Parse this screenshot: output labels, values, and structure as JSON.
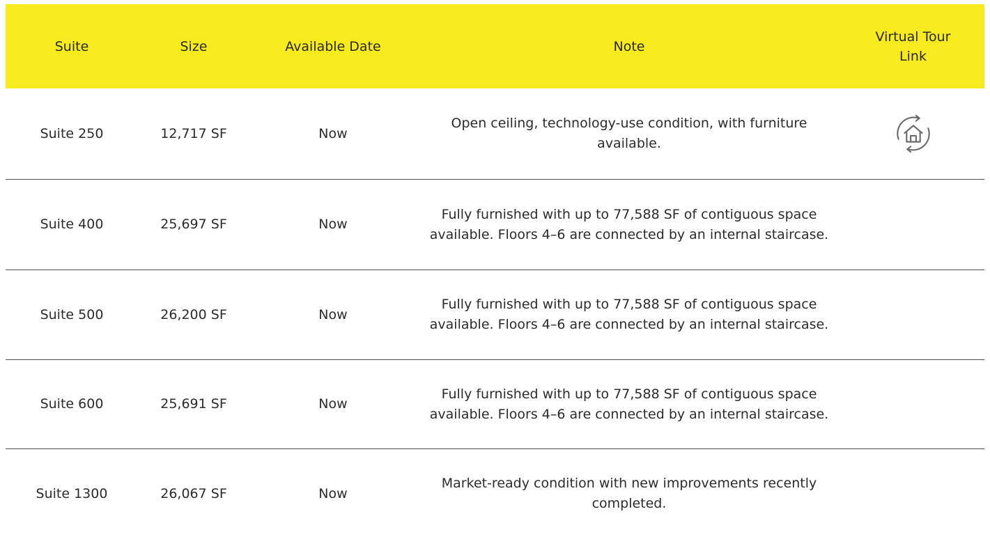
{
  "header": {
    "suite": "Suite",
    "size": "Size",
    "available_date": "Available Date",
    "note": "Note",
    "virtual_tour": "Virtual Tour Link"
  },
  "rows": [
    {
      "suite": "Suite 250",
      "size": "12,717 SF",
      "available": "Now",
      "note": "Open ceiling, technology-use condition, with furniture available.",
      "tour_icon": "virtual-tour-home-icon"
    },
    {
      "suite": "Suite 400",
      "size": "25,697 SF",
      "available": "Now",
      "note": "Fully furnished with up to 77,588 SF of contiguous space available. Floors 4–6 are connected by an internal staircase."
    },
    {
      "suite": "Suite 500",
      "size": "26,200 SF",
      "available": "Now",
      "note": "Fully furnished with up to 77,588 SF of contiguous space available. Floors 4–6 are connected by an internal staircase."
    },
    {
      "suite": "Suite 600",
      "size": "25,691 SF",
      "available": "Now",
      "note": "Fully furnished with up to 77,588 SF of contiguous space available. Floors 4–6 are connected by an internal staircase."
    },
    {
      "suite": "Suite 1300",
      "size": "26,067 SF",
      "available": "Now",
      "note": "Market-ready condition with new improvements recently completed."
    }
  ],
  "colors": {
    "header_background": "#f7ea1f",
    "divider": "#4a4a4a",
    "text": "#2b2b2b",
    "icon": "#6b6b6b"
  }
}
